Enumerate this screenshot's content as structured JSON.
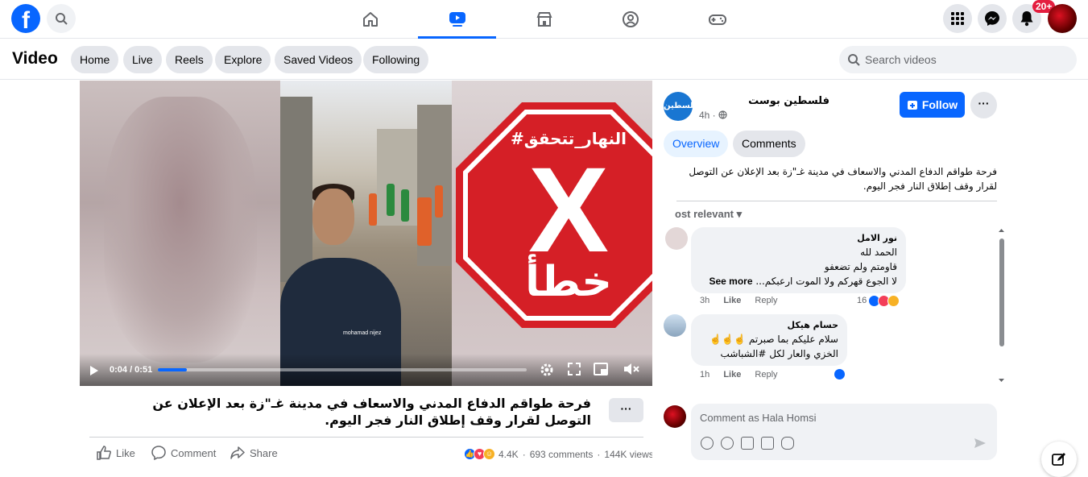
{
  "header": {
    "logo": "f",
    "badge": "20+",
    "icons": [
      "search-icon",
      "home-icon",
      "video-icon",
      "marketplace-icon",
      "groups-icon",
      "gaming-icon",
      "menu-grid-icon",
      "messenger-icon",
      "bell-icon"
    ]
  },
  "subheader": {
    "title": "Video",
    "tabs": [
      "Home",
      "Live",
      "Reels",
      "Explore",
      "Saved Videos",
      "Following"
    ],
    "search_placeholder": "Search videos"
  },
  "video": {
    "overlay_tag": "#النهار_تتحقق",
    "overlay_verdict": "خطأ",
    "overlay_mark": "X",
    "watermark": "mohamad nijez",
    "time": "0:04 / 0:51",
    "progress_fraction": 0.078
  },
  "caption": {
    "text": "فرحة طواقم الدفاع المدني والاسعاف في مدينة غـ\"زة بعد الإعلان عن التوصل لقرار وقف إطلاق النار فجر اليوم.",
    "more": "···"
  },
  "actions": {
    "like": "Like",
    "comment": "Comment",
    "share": "Share",
    "reactions": "4.4K",
    "comments_count": "693 comments",
    "views": "144K views",
    "sep": "·"
  },
  "panel": {
    "page_avatar_text": "فلسطين",
    "page_name": "فلسطين بوست",
    "time": "4h ·",
    "follow": "Follow",
    "more": "···",
    "tabs": [
      "Overview",
      "Comments"
    ],
    "post_text": "فرحة طواقم الدفاع المدني والاسعاف في مدينة غـ\"زة بعد الإعلان عن التوصل لقرار وقف إطلاق النار فجر اليوم.",
    "sort_label": "ost relevant ▾"
  },
  "comments": [
    {
      "author": "نور الامل",
      "lines": [
        "الحمد لله",
        "قاومتم ولم تضعفو",
        "لا الجوع قهركم ولا الموت ارعبكم..."
      ],
      "see_more": "See more",
      "time": "3h",
      "like": "Like",
      "reply": "Reply",
      "reaction_count": "16"
    },
    {
      "author": "حسام هيكل",
      "lines": [
        "سلام عليكم بما صبرتم ☝️☝️☝️",
        "الخزي والعار لكل #الشباشب"
      ],
      "time": "1h",
      "like": "Like",
      "reply": "Reply"
    }
  ],
  "composer": {
    "placeholder": "Comment as Hala Homsi"
  },
  "colors": {
    "brand": "#0866ff",
    "stop_red": "#d51f26",
    "badge": "#e41e3f"
  }
}
